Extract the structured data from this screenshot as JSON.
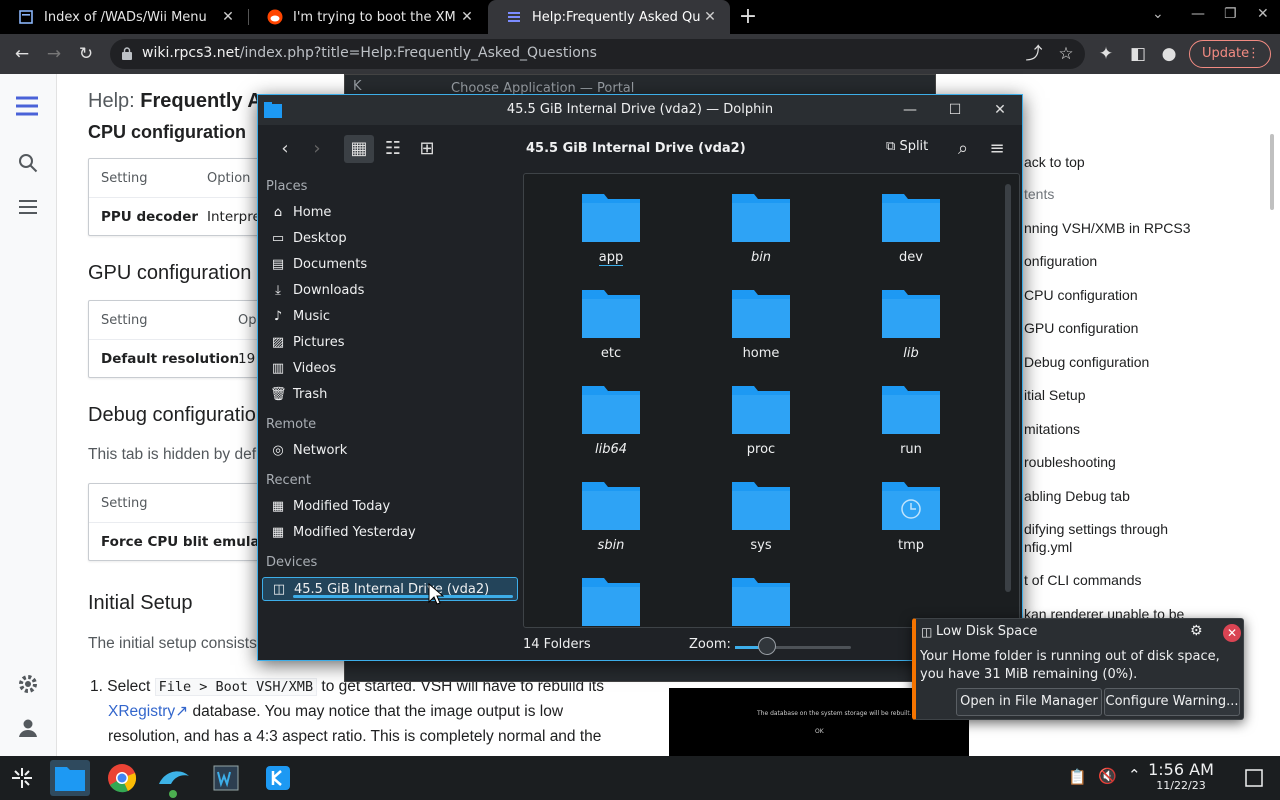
{
  "browser": {
    "tabs": [
      {
        "title": "Index of /WADs/Wii Menu",
        "active": false
      },
      {
        "title": "I'm trying to boot the XMB on",
        "active": false
      },
      {
        "title": "Help:Frequently Asked Quest",
        "active": true
      }
    ],
    "url_host": "wiki.rpcs3.net",
    "url_path": "/index.php?title=Help:Frequently_Asked_Questions",
    "update_label": "Update"
  },
  "wiki": {
    "title_prefix": "Help:",
    "title_main": "Frequently As",
    "cpu_heading": "CPU configuration",
    "gpu_heading": "GPU configuration",
    "debug_heading": "Debug configuration",
    "initial_heading": "Initial Setup",
    "table_setting": "Setting",
    "cpu_option": "Option",
    "cpu_row": "PPU decoder",
    "cpu_value": "Interpre",
    "gpu_option": "Op",
    "gpu_row": "Default resolution",
    "gpu_value": "19",
    "debug_row": "Force CPU blit emulation",
    "debug_text": "This tab is hidden by def",
    "initial_text": "The initial setup consists",
    "list_select": "Select",
    "list_code": "File > Boot VSH/XMB",
    "list_rest": "to get started. VSH will have to rebuild its",
    "list_link": "XRegistry",
    "list_line2": "database. You may notice that the image output is low",
    "list_line3": "resolution, and has a 4:3 aspect ratio. This is completely normal and the",
    "video_caption": "The database on the system storage will be rebuilt.",
    "video_ok": "OK",
    "toc": [
      "ack to top",
      "tents",
      "nning VSH/XMB in RPCS3",
      "onfiguration",
      "CPU configuration",
      "GPU configuration",
      "Debug configuration",
      "itial Setup",
      "mitations",
      "roubleshooting",
      "abling Debug tab",
      "difying settings through",
      "nfig.yml",
      "t of CLI commands",
      "kan renderer unable to be"
    ]
  },
  "portal": {
    "title": "Choose Application — Portal"
  },
  "dolphin": {
    "window_title": "45.5 GiB Internal Drive (vda2) — Dolphin",
    "location": "45.5 GiB Internal Drive (vda2)",
    "split_label": "Split",
    "places_heading": "Places",
    "places": [
      "Home",
      "Desktop",
      "Documents",
      "Downloads",
      "Music",
      "Pictures",
      "Videos",
      "Trash"
    ],
    "remote_heading": "Remote",
    "remote": [
      "Network"
    ],
    "recent_heading": "Recent",
    "recent": [
      "Modified Today",
      "Modified Yesterday"
    ],
    "devices_heading": "Devices",
    "devices": [
      "45.5 GiB Internal Drive (vda2)"
    ],
    "folders": [
      {
        "name": "app",
        "style": "underline"
      },
      {
        "name": "bin",
        "style": "italic"
      },
      {
        "name": "dev",
        "style": "normal"
      },
      {
        "name": "etc",
        "style": "normal"
      },
      {
        "name": "home",
        "style": "normal"
      },
      {
        "name": "lib",
        "style": "italic"
      },
      {
        "name": "lib64",
        "style": "italic"
      },
      {
        "name": "proc",
        "style": "normal"
      },
      {
        "name": "run",
        "style": "normal"
      },
      {
        "name": "sbin",
        "style": "italic"
      },
      {
        "name": "sys",
        "style": "normal"
      },
      {
        "name": "tmp",
        "style": "normal"
      }
    ],
    "status_count": "14 Folders",
    "zoom_label": "Zoom:",
    "zoom_level": 0.28
  },
  "notification": {
    "title": "Low Disk Space",
    "body_line1": "Your Home folder is running out of disk space,",
    "body_line2": "you have 31 MiB remaining (0%).",
    "btn_open": "Open in File Manager",
    "btn_configure": "Configure Warning..."
  },
  "taskbar": {
    "time": "1:56 AM",
    "date": "11/22/23"
  },
  "colors": {
    "accent": "#3daee9",
    "folder": "#1d99f3",
    "warning": "#f67400",
    "chrome_update": "#f28b82"
  }
}
